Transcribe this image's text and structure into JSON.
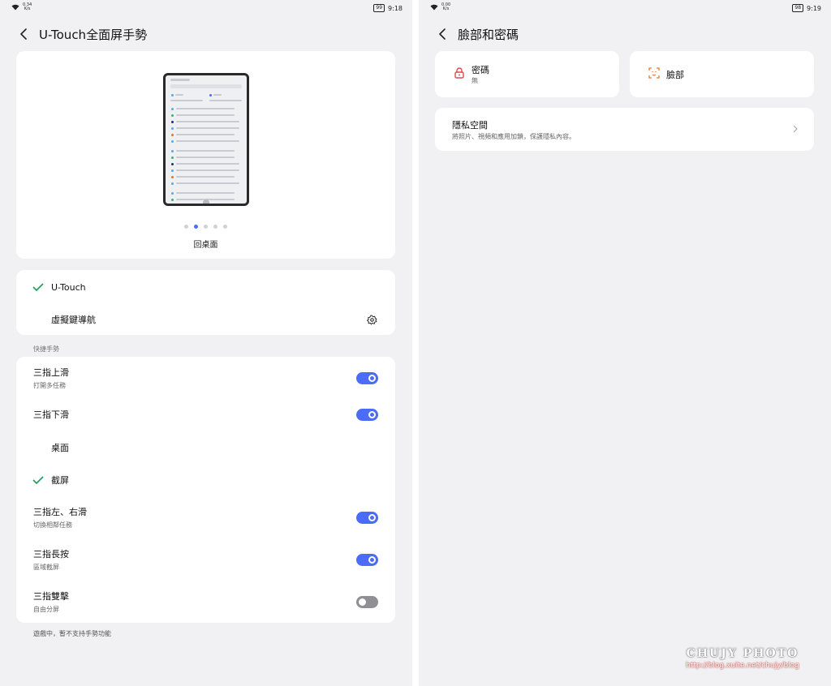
{
  "left": {
    "status": {
      "speed_value": "0.34",
      "speed_unit": "K/s",
      "battery": "99",
      "time": "9:18"
    },
    "header": {
      "title": "U-Touch全面屏手勢"
    },
    "preview": {
      "caption": "回桌面",
      "pages": 5,
      "active_page": 2
    },
    "navigation": {
      "options": [
        {
          "label": "U-Touch",
          "selected": true
        },
        {
          "label": "虛擬鍵導航",
          "selected": false
        }
      ]
    },
    "shortcut_section_label": "快捷手勢",
    "gestures": [
      {
        "title": "三指上滑",
        "subtitle": "打開多任務",
        "enabled": true
      },
      {
        "title": "三指下滑",
        "subtitle": "",
        "enabled": true
      },
      {
        "title": "桌面",
        "type": "option",
        "selected": false
      },
      {
        "title": "截屏",
        "type": "option",
        "selected": true
      },
      {
        "title": "三指左、右滑",
        "subtitle": "切換相鄰任務",
        "enabled": true
      },
      {
        "title": "三指長按",
        "subtitle": "區域截屏",
        "enabled": true
      },
      {
        "title": "三指雙擊",
        "subtitle": "自由分屏",
        "enabled": false
      }
    ],
    "footnote": "遊戲中，暫不支持手勢功能"
  },
  "right": {
    "status": {
      "speed_value": "0.00",
      "speed_unit": "K/s",
      "battery": "98",
      "time": "9:19"
    },
    "header": {
      "title": "臉部和密碼"
    },
    "password_tile": {
      "title": "密碼",
      "subtitle": "無"
    },
    "face_tile": {
      "title": "臉部"
    },
    "privacy": {
      "title": "隱私空間",
      "subtitle": "將照片、視頻和應用加鎖，保護隱私內容。"
    }
  },
  "watermark": {
    "brand": "CHUJY PHOTO",
    "url": "http://blog.xuite.net/chujy/blog"
  },
  "colors": {
    "accent": "#4a6cf7",
    "check": "#1a9e5c",
    "lock": "#e0484e",
    "face": "#e87a3b",
    "toggle_off": "#8f8f94"
  }
}
